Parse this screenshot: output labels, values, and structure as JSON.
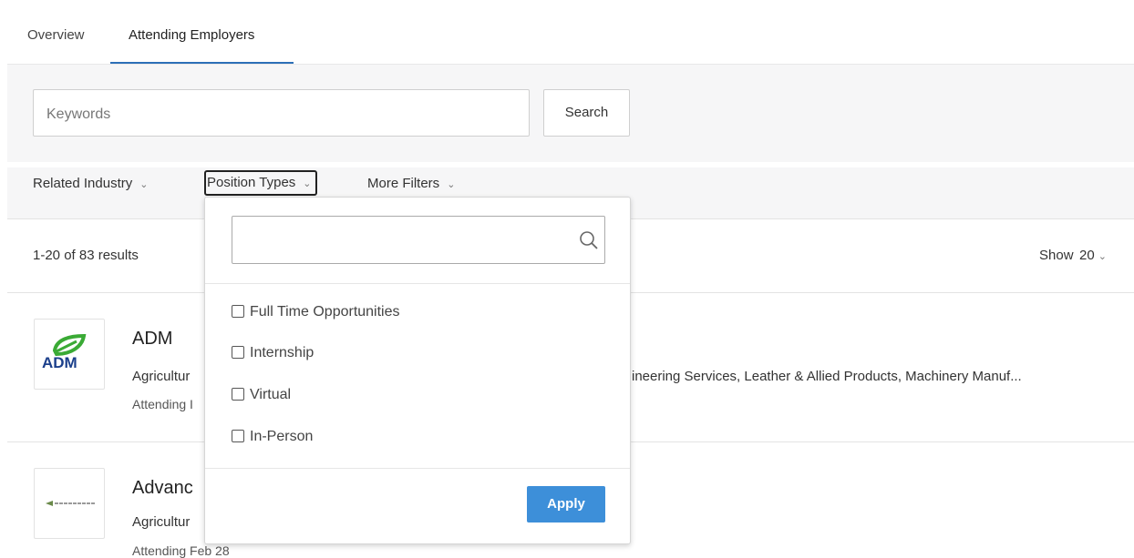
{
  "tabs": [
    {
      "label": "Overview",
      "active": false
    },
    {
      "label": "Attending Employers",
      "active": true
    }
  ],
  "search": {
    "placeholder": "Keywords",
    "button_label": "Search"
  },
  "filters": {
    "related_industry": "Related Industry",
    "position_types": "Position Types",
    "more_filters": "More Filters"
  },
  "results": {
    "count_text": "1-20 of 83 results",
    "show_label": "Show",
    "show_value": "20"
  },
  "employers": [
    {
      "name": "ADM",
      "logo_text": "ADM",
      "industries": "Agricultur",
      "industries_tail": "ineering Services, Leather & Allied Products, Machinery Manuf...",
      "attending": "Attending I"
    },
    {
      "name": "Advanc",
      "industries": "Agricultur",
      "attending": "Attending Feb 28"
    }
  ],
  "position_dropdown": {
    "options": [
      {
        "label": "Full Time Opportunities",
        "checked": false
      },
      {
        "label": "Internship",
        "checked": false
      },
      {
        "label": "Virtual",
        "checked": false
      },
      {
        "label": "In-Person",
        "checked": false
      }
    ],
    "apply_label": "Apply"
  },
  "colors": {
    "accent": "#2c6fb7",
    "apply_button": "#3d8fd9",
    "adm_green": "#3aaa35",
    "adm_blue": "#1b3f8b"
  },
  "icons": {
    "chevron": "chevron-down-icon",
    "search": "search-icon"
  }
}
